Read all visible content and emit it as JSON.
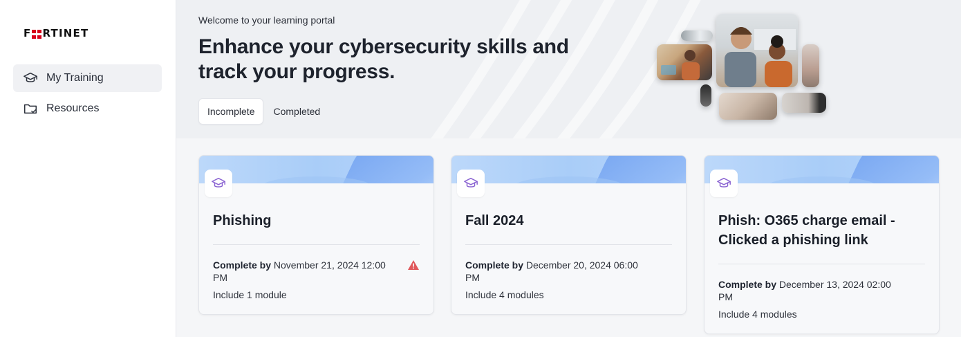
{
  "brand": {
    "logo_pre": "F",
    "logo_post": "RTINET",
    "accent": "#d7001a"
  },
  "sidebar": {
    "items": [
      {
        "label": "My Training",
        "icon": "graduation-cap-icon",
        "active": true
      },
      {
        "label": "Resources",
        "icon": "folder-icon",
        "active": false
      }
    ]
  },
  "hero": {
    "welcome": "Welcome to your learning portal",
    "headline": "Enhance your cybersecurity skills and track your progress.",
    "tabs": [
      {
        "label": "Incomplete",
        "selected": true
      },
      {
        "label": "Completed",
        "selected": false
      }
    ]
  },
  "cards": [
    {
      "title": "Phishing",
      "due_label": "Complete by",
      "due_date": "November 21, 2024 12:00 PM",
      "modules": "Include 1 module",
      "warning": true,
      "icon": "graduation-cap-icon"
    },
    {
      "title": "Fall 2024",
      "due_label": "Complete by",
      "due_date": "December 20, 2024 06:00 PM",
      "modules": "Include 4 modules",
      "warning": false,
      "icon": "graduation-cap-icon"
    },
    {
      "title": "Phish: O365 charge email - Clicked a phishing link",
      "due_label": "Complete by",
      "due_date": "December 13, 2024 02:00 PM",
      "modules": "Include 4 modules",
      "warning": false,
      "icon": "graduation-cap-icon"
    }
  ],
  "colors": {
    "warning": "#e0575b",
    "card_icon": "#8a63d2"
  }
}
